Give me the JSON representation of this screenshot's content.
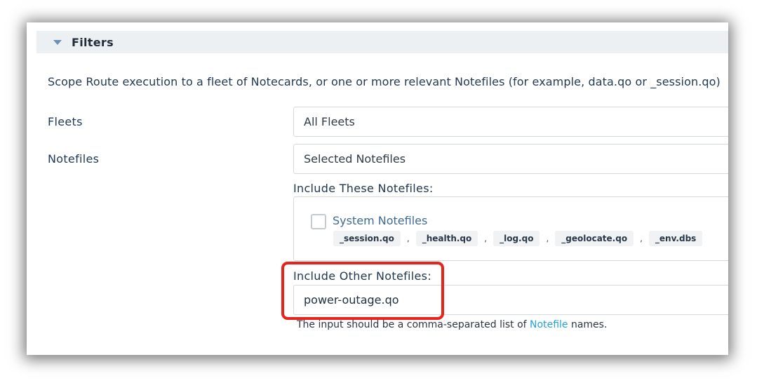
{
  "filters": {
    "title": "Filters",
    "description": "Scope Route execution to a fleet of Notecards, or one or more relevant Notefiles (for example, data.qo or _session.qo)",
    "fleets_label": "Fleets",
    "fleets_value": "All Fleets",
    "notefiles_label": "Notefiles",
    "notefiles_value": "Selected Notefiles",
    "include_these_label": "Include These Notefiles:",
    "system_notefiles_label": "System Notefiles",
    "system_notefiles_checked": false,
    "system_tags": [
      "_session.qo",
      "_health.qo",
      "_log.qo",
      "_geolocate.qo",
      "_env.dbs"
    ],
    "include_other_label": "Include Other Notefiles:",
    "include_other_value": "power-outage.qo",
    "hint_prefix": "The input should be a comma-separated list of",
    "hint_link": "Notefile",
    "hint_suffix": "names.",
    "highlight_color": "#e8231c",
    "link_color": "#22a3d8"
  }
}
